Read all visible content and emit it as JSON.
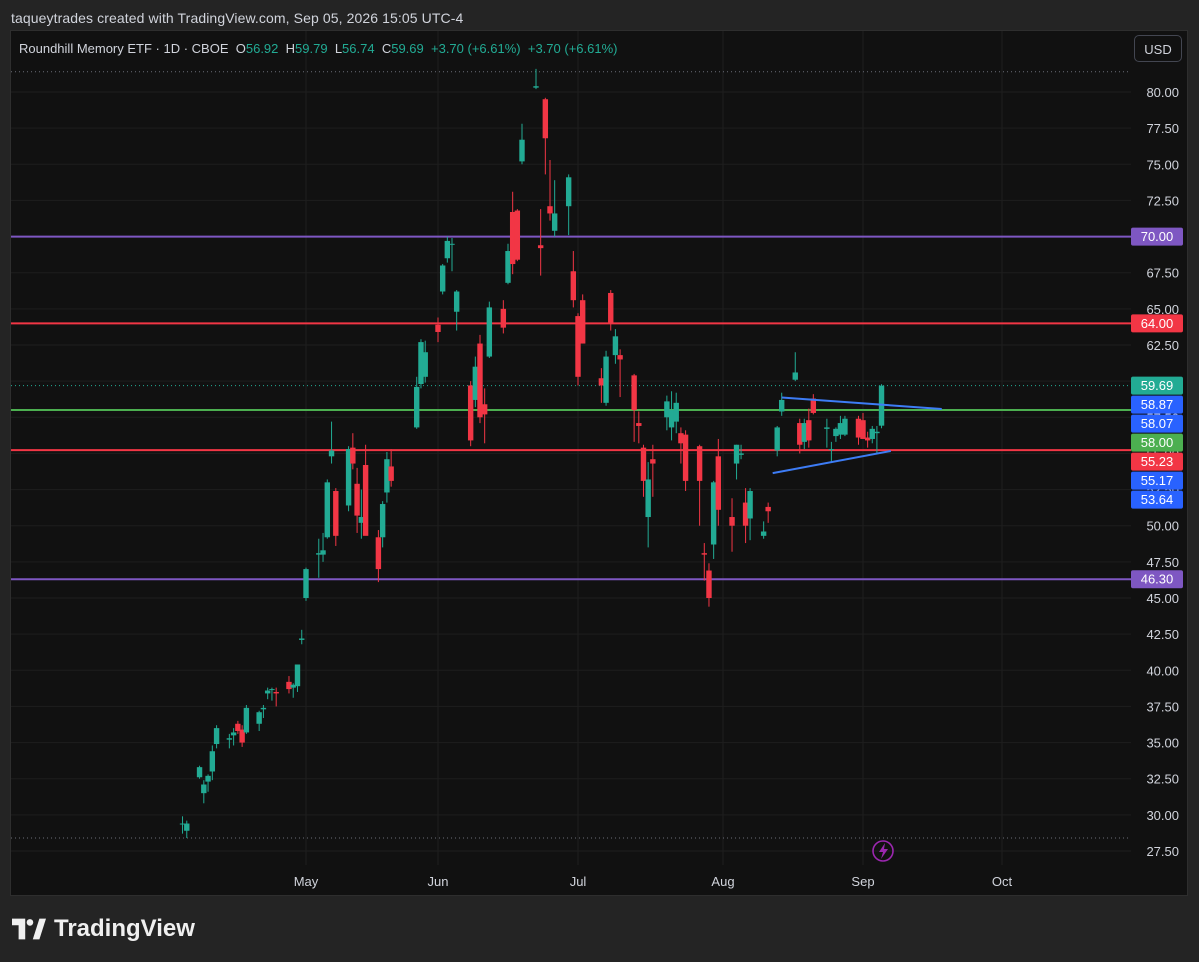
{
  "header": {
    "credit": "taqueytrades created with TradingView.com, Sep 05, 2026 15:05 UTC-4"
  },
  "legend": {
    "symbol": "Roundhill Memory ETF · 1D · CBOE",
    "open_label": "O",
    "open": "56.92",
    "high_label": "H",
    "high": "59.79",
    "low_label": "L",
    "low": "56.74",
    "close_label": "C",
    "close": "59.69",
    "change1": "+3.70 (+6.61%)",
    "change2": "+3.70 (+6.61%)"
  },
  "currency_button": "USD",
  "brand": {
    "name": "TradingView"
  },
  "colors": {
    "up": "#22ab94",
    "down": "#f23645",
    "purple": "#7e57c2",
    "red": "#f23645",
    "green": "#4caf50",
    "blue": "#2962ff",
    "trendline": "#3d7cf5",
    "background": "#111111"
  },
  "chart_data": {
    "type": "candlestick",
    "ylim": [
      26.5,
      81.6
    ],
    "yticks": [
      80,
      77.5,
      75,
      72.5,
      70,
      67.5,
      65,
      62.5,
      60,
      57.5,
      55,
      52.5,
      50,
      47.5,
      45,
      42.5,
      40,
      37.5,
      35,
      32.5,
      30,
      27.5
    ],
    "ytick_labels": [
      "80.00",
      "77.50",
      "75.00",
      "72.50",
      "70.00",
      "67.50",
      "65.00",
      "62.50",
      "60.00",
      "57.50",
      "55.00",
      "52.50",
      "50.00",
      "47.50",
      "45.00",
      "42.50",
      "40.00",
      "37.50",
      "35.00",
      "32.50",
      "30.00",
      "27.50"
    ],
    "xlabels": [
      {
        "label": "May",
        "date": "2026-05-01"
      },
      {
        "label": "Jun",
        "date": "2026-06-01"
      },
      {
        "label": "Jul",
        "date": "2026-07-01"
      },
      {
        "label": "Aug",
        "date": "2026-08-01"
      },
      {
        "label": "Sep",
        "date": "2026-09-01"
      },
      {
        "label": "Oct",
        "date": "2026-10-01"
      }
    ],
    "candles": [
      {
        "date": "2026-04-02",
        "o": 29.4,
        "h": 29.9,
        "l": 28.7,
        "c": 29.4
      },
      {
        "date": "2026-04-03",
        "o": 28.9,
        "h": 29.6,
        "l": 28.4,
        "c": 29.4
      },
      {
        "date": "2026-04-06",
        "o": 32.6,
        "h": 33.4,
        "l": 32.5,
        "c": 33.3
      },
      {
        "date": "2026-04-07",
        "o": 31.5,
        "h": 32.4,
        "l": 30.8,
        "c": 32.1
      },
      {
        "date": "2026-04-08",
        "o": 32.3,
        "h": 32.8,
        "l": 31.6,
        "c": 32.7
      },
      {
        "date": "2026-04-09",
        "o": 33.0,
        "h": 34.8,
        "l": 32.4,
        "c": 34.4
      },
      {
        "date": "2026-04-10",
        "o": 34.9,
        "h": 36.2,
        "l": 34.6,
        "c": 36.0
      },
      {
        "date": "2026-04-13",
        "o": 35.2,
        "h": 35.6,
        "l": 34.6,
        "c": 35.3
      },
      {
        "date": "2026-04-14",
        "o": 35.5,
        "h": 36.0,
        "l": 34.8,
        "c": 35.7
      },
      {
        "date": "2026-04-15",
        "o": 36.3,
        "h": 36.5,
        "l": 35.6,
        "c": 35.8
      },
      {
        "date": "2026-04-16",
        "o": 35.9,
        "h": 36.2,
        "l": 34.7,
        "c": 35.0
      },
      {
        "date": "2026-04-17",
        "o": 35.7,
        "h": 37.6,
        "l": 35.6,
        "c": 37.4
      },
      {
        "date": "2026-04-20",
        "o": 36.3,
        "h": 37.2,
        "l": 35.8,
        "c": 37.1
      },
      {
        "date": "2026-04-21",
        "o": 37.3,
        "h": 37.6,
        "l": 36.7,
        "c": 37.4
      },
      {
        "date": "2026-04-22",
        "o": 38.4,
        "h": 38.8,
        "l": 38.0,
        "c": 38.6
      },
      {
        "date": "2026-04-23",
        "o": 38.7,
        "h": 38.8,
        "l": 37.9,
        "c": 38.7
      },
      {
        "date": "2026-04-24",
        "o": 38.5,
        "h": 38.8,
        "l": 37.5,
        "c": 38.4
      },
      {
        "date": "2026-04-27",
        "o": 39.2,
        "h": 39.6,
        "l": 38.4,
        "c": 38.7
      },
      {
        "date": "2026-04-28",
        "o": 38.8,
        "h": 39.1,
        "l": 38.1,
        "c": 39.0
      },
      {
        "date": "2026-04-29",
        "o": 38.9,
        "h": 40.4,
        "l": 38.5,
        "c": 40.4
      },
      {
        "date": "2026-04-30",
        "o": 42.1,
        "h": 42.8,
        "l": 41.8,
        "c": 42.2
      },
      {
        "date": "2026-05-01",
        "o": 45.0,
        "h": 47.1,
        "l": 44.8,
        "c": 47.0
      },
      {
        "date": "2026-05-04",
        "o": 48.0,
        "h": 49.1,
        "l": 46.4,
        "c": 48.1
      },
      {
        "date": "2026-05-05",
        "o": 48.0,
        "h": 49.5,
        "l": 47.5,
        "c": 48.3
      },
      {
        "date": "2026-05-06",
        "o": 49.2,
        "h": 53.2,
        "l": 49.1,
        "c": 53.0
      },
      {
        "date": "2026-05-07",
        "o": 54.8,
        "h": 57.2,
        "l": 54.3,
        "c": 55.2
      },
      {
        "date": "2026-05-08",
        "o": 52.4,
        "h": 52.6,
        "l": 48.6,
        "c": 49.3
      },
      {
        "date": "2026-05-11",
        "o": 51.4,
        "h": 55.5,
        "l": 51.0,
        "c": 55.3
      },
      {
        "date": "2026-05-12",
        "o": 55.4,
        "h": 56.4,
        "l": 53.9,
        "c": 54.3
      },
      {
        "date": "2026-05-13",
        "o": 52.9,
        "h": 54.0,
        "l": 49.5,
        "c": 50.7
      },
      {
        "date": "2026-05-14",
        "o": 50.2,
        "h": 52.5,
        "l": 49.1,
        "c": 50.6
      },
      {
        "date": "2026-05-15",
        "o": 54.2,
        "h": 55.6,
        "l": 51.1,
        "c": 49.3
      },
      {
        "date": "2026-05-18",
        "o": 49.2,
        "h": 49.7,
        "l": 46.1,
        "c": 47.0
      },
      {
        "date": "2026-05-19",
        "o": 49.2,
        "h": 51.7,
        "l": 48.5,
        "c": 51.5
      },
      {
        "date": "2026-05-20",
        "o": 52.3,
        "h": 55.1,
        "l": 51.6,
        "c": 54.6
      },
      {
        "date": "2026-05-21",
        "o": 54.1,
        "h": 55.3,
        "l": 52.7,
        "c": 53.1
      },
      {
        "date": "2026-05-27",
        "o": 56.8,
        "h": 60.3,
        "l": 56.7,
        "c": 59.6
      },
      {
        "date": "2026-05-28",
        "o": 59.8,
        "h": 62.9,
        "l": 59.5,
        "c": 62.7
      },
      {
        "date": "2026-05-29",
        "o": 60.3,
        "h": 62.8,
        "l": 59.9,
        "c": 62.0
      },
      {
        "date": "2026-06-01",
        "o": 63.9,
        "h": 64.4,
        "l": 62.7,
        "c": 63.4
      },
      {
        "date": "2026-06-02",
        "o": 66.2,
        "h": 68.1,
        "l": 66.0,
        "c": 68.0
      },
      {
        "date": "2026-06-03",
        "o": 68.5,
        "h": 70.0,
        "l": 68.2,
        "c": 69.7
      },
      {
        "date": "2026-06-04",
        "o": 69.5,
        "h": 69.9,
        "l": 67.6,
        "c": 69.5
      },
      {
        "date": "2026-06-05",
        "o": 64.8,
        "h": 66.3,
        "l": 63.5,
        "c": 66.2
      },
      {
        "date": "2026-06-08",
        "o": 59.7,
        "h": 60.0,
        "l": 55.5,
        "c": 55.9
      },
      {
        "date": "2026-06-09",
        "o": 58.7,
        "h": 61.7,
        "l": 58.2,
        "c": 61.0
      },
      {
        "date": "2026-06-10",
        "o": 62.6,
        "h": 63.2,
        "l": 57.1,
        "c": 57.5
      },
      {
        "date": "2026-06-11",
        "o": 58.4,
        "h": 59.5,
        "l": 55.7,
        "c": 57.7
      },
      {
        "date": "2026-06-12",
        "o": 61.7,
        "h": 65.5,
        "l": 61.6,
        "c": 65.1
      },
      {
        "date": "2026-06-15",
        "o": 65.0,
        "h": 65.6,
        "l": 63.3,
        "c": 63.7
      },
      {
        "date": "2026-06-16",
        "o": 66.8,
        "h": 69.5,
        "l": 66.7,
        "c": 69.0
      },
      {
        "date": "2026-06-17",
        "o": 71.7,
        "h": 73.1,
        "l": 67.4,
        "c": 68.1
      },
      {
        "date": "2026-06-18",
        "o": 71.8,
        "h": 71.9,
        "l": 68.3,
        "c": 68.4
      },
      {
        "date": "2026-06-19",
        "o": 75.2,
        "h": 77.8,
        "l": 75.0,
        "c": 76.7
      },
      {
        "date": "2026-06-22",
        "o": 80.3,
        "h": 81.6,
        "l": 80.2,
        "c": 80.4
      },
      {
        "date": "2026-06-23",
        "o": 69.4,
        "h": 71.9,
        "l": 67.3,
        "c": 69.2
      },
      {
        "date": "2026-06-24",
        "o": 79.5,
        "h": 79.6,
        "l": 74.3,
        "c": 76.8
      },
      {
        "date": "2026-06-25",
        "o": 72.1,
        "h": 75.3,
        "l": 71.1,
        "c": 71.6
      },
      {
        "date": "2026-06-26",
        "o": 70.4,
        "h": 73.9,
        "l": 70.0,
        "c": 71.6
      },
      {
        "date": "2026-06-29",
        "o": 72.1,
        "h": 74.3,
        "l": 70.1,
        "c": 74.1
      },
      {
        "date": "2026-06-30",
        "o": 67.6,
        "h": 69.0,
        "l": 65.1,
        "c": 65.6
      },
      {
        "date": "2026-07-01",
        "o": 64.5,
        "h": 64.7,
        "l": 59.7,
        "c": 60.3
      },
      {
        "date": "2026-07-02",
        "o": 65.6,
        "h": 66.0,
        "l": 62.6,
        "c": 62.6
      },
      {
        "date": "2026-07-06",
        "o": 60.2,
        "h": 60.9,
        "l": 58.5,
        "c": 59.7
      },
      {
        "date": "2026-07-07",
        "o": 58.5,
        "h": 62.1,
        "l": 58.3,
        "c": 61.7
      },
      {
        "date": "2026-07-08",
        "o": 66.1,
        "h": 66.3,
        "l": 63.5,
        "c": 64.0
      },
      {
        "date": "2026-07-09",
        "o": 61.8,
        "h": 63.6,
        "l": 61.2,
        "c": 63.1
      },
      {
        "date": "2026-07-10",
        "o": 61.8,
        "h": 62.2,
        "l": 58.9,
        "c": 61.5
      },
      {
        "date": "2026-07-13",
        "o": 60.4,
        "h": 60.5,
        "l": 55.8,
        "c": 58.0
      },
      {
        "date": "2026-07-14",
        "o": 57.1,
        "h": 57.9,
        "l": 55.7,
        "c": 56.9
      },
      {
        "date": "2026-07-15",
        "o": 55.4,
        "h": 55.6,
        "l": 52.0,
        "c": 53.1
      },
      {
        "date": "2026-07-16",
        "o": 50.6,
        "h": 54.4,
        "l": 48.5,
        "c": 53.2
      },
      {
        "date": "2026-07-17",
        "o": 54.6,
        "h": 55.6,
        "l": 52.0,
        "c": 54.3
      },
      {
        "date": "2026-07-20",
        "o": 57.5,
        "h": 59.0,
        "l": 56.6,
        "c": 58.6
      },
      {
        "date": "2026-07-21",
        "o": 56.8,
        "h": 59.3,
        "l": 55.9,
        "c": 58.0
      },
      {
        "date": "2026-07-22",
        "o": 57.2,
        "h": 59.2,
        "l": 56.4,
        "c": 58.5
      },
      {
        "date": "2026-07-23",
        "o": 56.4,
        "h": 56.8,
        "l": 54.3,
        "c": 55.7
      },
      {
        "date": "2026-07-24",
        "o": 56.3,
        "h": 56.6,
        "l": 52.4,
        "c": 53.1
      },
      {
        "date": "2026-07-27",
        "o": 55.5,
        "h": 55.6,
        "l": 50.0,
        "c": 53.1
      },
      {
        "date": "2026-07-28",
        "o": 48.1,
        "h": 48.8,
        "l": 46.2,
        "c": 48.0
      },
      {
        "date": "2026-07-29",
        "o": 46.9,
        "h": 47.4,
        "l": 44.4,
        "c": 45.0
      },
      {
        "date": "2026-07-30",
        "o": 48.7,
        "h": 53.1,
        "l": 47.7,
        "c": 53.0
      },
      {
        "date": "2026-07-31",
        "o": 54.8,
        "h": 56.0,
        "l": 50.0,
        "c": 51.1
      },
      {
        "date": "2026-08-03",
        "o": 50.6,
        "h": 51.9,
        "l": 48.2,
        "c": 50.0
      },
      {
        "date": "2026-08-04",
        "o": 54.3,
        "h": 55.6,
        "l": 53.2,
        "c": 55.6
      },
      {
        "date": "2026-08-05",
        "o": 54.9,
        "h": 55.6,
        "l": 54.6,
        "c": 55.0
      },
      {
        "date": "2026-08-06",
        "o": 51.6,
        "h": 52.6,
        "l": 48.8,
        "c": 50.0
      },
      {
        "date": "2026-08-07",
        "o": 50.5,
        "h": 52.6,
        "l": 49.0,
        "c": 52.4
      },
      {
        "date": "2026-08-10",
        "o": 49.3,
        "h": 50.3,
        "l": 49.1,
        "c": 49.6
      },
      {
        "date": "2026-08-11",
        "o": 51.3,
        "h": 51.6,
        "l": 50.2,
        "c": 51.0
      },
      {
        "date": "2026-08-13",
        "o": 55.2,
        "h": 56.9,
        "l": 54.8,
        "c": 56.8
      },
      {
        "date": "2026-08-14",
        "o": 57.9,
        "h": 59.2,
        "l": 57.6,
        "c": 58.7
      },
      {
        "date": "2026-08-17",
        "o": 60.1,
        "h": 62.0,
        "l": 60.0,
        "c": 60.6
      },
      {
        "date": "2026-08-18",
        "o": 57.1,
        "h": 57.4,
        "l": 55.0,
        "c": 55.6
      },
      {
        "date": "2026-08-19",
        "o": 55.8,
        "h": 57.4,
        "l": 55.3,
        "c": 57.1
      },
      {
        "date": "2026-08-20",
        "o": 57.3,
        "h": 58.1,
        "l": 55.4,
        "c": 55.9
      },
      {
        "date": "2026-08-21",
        "o": 58.8,
        "h": 59.1,
        "l": 57.7,
        "c": 57.8
      },
      {
        "date": "2026-08-24",
        "o": 56.7,
        "h": 57.4,
        "l": 55.4,
        "c": 56.8
      },
      {
        "date": "2026-08-25",
        "o": 55.3,
        "h": 55.8,
        "l": 54.4,
        "c": 55.3
      },
      {
        "date": "2026-08-26",
        "o": 56.2,
        "h": 56.8,
        "l": 55.8,
        "c": 56.7
      },
      {
        "date": "2026-08-27",
        "o": 56.3,
        "h": 57.6,
        "l": 56.0,
        "c": 57.1
      },
      {
        "date": "2026-08-28",
        "o": 56.3,
        "h": 57.6,
        "l": 56.2,
        "c": 57.4
      },
      {
        "date": "2026-08-31",
        "o": 57.4,
        "h": 57.6,
        "l": 55.6,
        "c": 56.1
      },
      {
        "date": "2026-09-01",
        "o": 57.3,
        "h": 57.8,
        "l": 56.2,
        "c": 56.0
      },
      {
        "date": "2026-09-02",
        "o": 56.1,
        "h": 56.5,
        "l": 55.4,
        "c": 55.9
      },
      {
        "date": "2026-09-03",
        "o": 56.0,
        "h": 56.9,
        "l": 55.7,
        "c": 56.7
      },
      {
        "date": "2026-09-04",
        "o": 56.4,
        "h": 56.9,
        "l": 55.0,
        "c": 56.5
      },
      {
        "date": "2026-09-05",
        "o": 56.92,
        "h": 59.79,
        "l": 56.74,
        "c": 59.69
      }
    ],
    "hlines": [
      {
        "price": 70.0,
        "color": "#7e57c2",
        "label": "70.00"
      },
      {
        "price": 64.0,
        "color": "#f23645",
        "label": "64.00"
      },
      {
        "price": 58.0,
        "color": "#4caf50",
        "label": "58.00"
      },
      {
        "price": 55.23,
        "color": "#f23645",
        "label": "55.23"
      },
      {
        "price": 46.3,
        "color": "#7e57c2",
        "label": "46.30"
      }
    ],
    "price_badges": [
      {
        "price": 59.69,
        "label": "59.69",
        "color": "#22ab94"
      },
      {
        "price": 58.87,
        "label": "58.87",
        "color": "#2962ff"
      },
      {
        "price": 58.07,
        "label": "58.07",
        "color": "#2962ff"
      },
      {
        "price": 58.0,
        "label": "58.00",
        "color": "#4caf50"
      },
      {
        "price": 55.23,
        "label": "55.23",
        "color": "#f23645"
      },
      {
        "price": 55.17,
        "label": "55.17",
        "color": "#2962ff"
      },
      {
        "price": 53.64,
        "label": "53.64",
        "color": "#2962ff"
      }
    ],
    "trendlines": [
      {
        "name": "triangle-upper",
        "from": {
          "date": "2026-08-14",
          "price": 58.87
        },
        "to": {
          "date": "2026-09-18",
          "price": 58.07
        }
      },
      {
        "name": "triangle-lower",
        "from": {
          "date": "2026-08-12",
          "price": 53.64
        },
        "to": {
          "date": "2026-09-07",
          "price": 55.17
        }
      }
    ],
    "dotted_lines": [
      {
        "price": 81.4
      },
      {
        "price": 59.69
      },
      {
        "price": 28.4
      }
    ]
  }
}
